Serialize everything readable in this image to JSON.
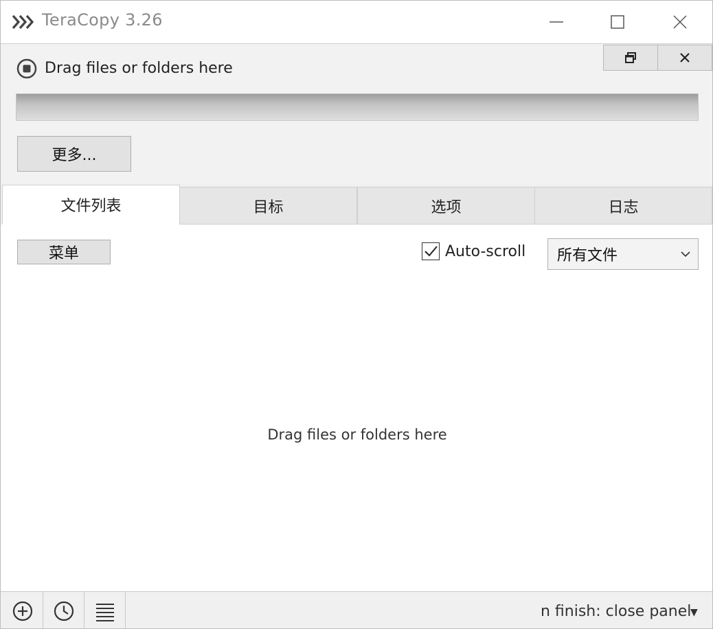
{
  "window": {
    "title": "TeraCopy 3.26"
  },
  "top_panel": {
    "status_text": "Drag files or folders here",
    "progress": 0,
    "more_button": "更多..."
  },
  "tabs": [
    {
      "label": "文件列表",
      "active": true
    },
    {
      "label": "目标",
      "active": false
    },
    {
      "label": "选项",
      "active": false
    },
    {
      "label": "日志",
      "active": false
    }
  ],
  "content": {
    "menu_button": "菜单",
    "autoscroll_label": "Auto-scroll",
    "autoscroll_checked": true,
    "filter_selected": "所有文件",
    "drop_hint": "Drag files or folders here"
  },
  "bottom_bar": {
    "finish_text": "n finish: close panel"
  },
  "icons": {
    "app": "teracopy-chevrons-icon",
    "status": "stop-circle-icon",
    "add": "plus-circle-icon",
    "history": "clock-icon",
    "list": "list-icon"
  },
  "colors": {
    "title_text": "#8a8a8a",
    "panel_bg": "#f2f2f2",
    "button_bg": "#e2e2e2"
  }
}
